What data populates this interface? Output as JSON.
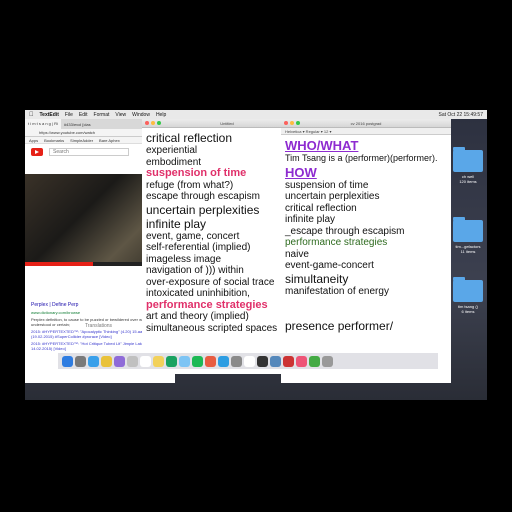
{
  "menubar": {
    "app": "TextEdit",
    "items": [
      "File",
      "Edit",
      "Format",
      "View",
      "Window",
      "Help"
    ],
    "clock": "Sat Oct 22  15:49:57"
  },
  "browser": {
    "tabs": [
      "t i m t s a n g | Ri",
      "#433/evol [clas"
    ],
    "url": "https://www.youtube.com/watch",
    "bookmarks": [
      "Apps",
      "Bookmarks",
      "SimpleAdder",
      "Bare Aphex"
    ],
    "search_placeholder": "Search",
    "translations_label": "Translations",
    "result_link": "Perplex | Define Perp",
    "result_url": "www.dictionary.com/browse",
    "result_snippet": "Perplex definition, to cause to be puzzled or bewildered over what is not understood or certain;",
    "history_1": "2015: #HYPERTEXTED™: \"Apocalyptic Thinking\" (4.20) 15.aat (•dell (19.02.2015) #SuperCollider #prorace [Video]",
    "history_2": "2015: #HYPERTEXTED™: \"Hot Critique Tubed Lit\" Jimpie Lakes (Bal/15 14.02.2015) [Video]"
  },
  "doc1": {
    "title": "Untitled",
    "lines": [
      {
        "t": "critical reflection",
        "c": "big"
      },
      {
        "t": "experiential",
        "c": ""
      },
      {
        "t": "embodiment",
        "c": ""
      },
      {
        "t": "suspension of time",
        "c": "pink"
      },
      {
        "t": "refuge (from what?)",
        "c": ""
      },
      {
        "t": "escape through escapism",
        "c": ""
      },
      {
        "t": "uncertain perplexities",
        "c": "big"
      },
      {
        "t": "infinite play",
        "c": "big"
      },
      {
        "t": "event, game, concert",
        "c": ""
      },
      {
        "t": "self-referential (implied)",
        "c": ""
      },
      {
        "t": "imageless image",
        "c": ""
      },
      {
        "t": "navigation of ))) within",
        "c": ""
      },
      {
        "t": "over-exposure of social trace",
        "c": ""
      },
      {
        "t": "intoxicated uninhibition,",
        "c": ""
      },
      {
        "t": "performance strategies",
        "c": "pink"
      },
      {
        "t": "art and theory (implied)",
        "c": ""
      },
      {
        "t": "simultaneous scripted spaces",
        "c": ""
      }
    ]
  },
  "doc2": {
    "title": "cv 2016 postgrad",
    "lines": [
      {
        "t": "WHO/WHAT",
        "c": "purple"
      },
      {
        "t": "Tim Tsang is a (performer)(performer).",
        "c": "small"
      },
      {
        "t": "HOW",
        "c": "purple"
      },
      {
        "t": "suspension of time",
        "c": ""
      },
      {
        "t": "uncertain perplexities",
        "c": ""
      },
      {
        "t": "critical reflection",
        "c": ""
      },
      {
        "t": "infinite play",
        "c": ""
      },
      {
        "t": "_escape through escapism",
        "c": ""
      },
      {
        "t": "performance strategies",
        "c": "green"
      },
      {
        "t": "naive",
        "c": ""
      },
      {
        "t": "event-game-concert",
        "c": ""
      },
      {
        "t": "simultaneity",
        "c": "big"
      },
      {
        "t": "manifestation of energy",
        "c": ""
      },
      {
        "t": "",
        "c": ""
      },
      {
        "t": "",
        "c": ""
      },
      {
        "t": "presence performer/",
        "c": "big"
      }
    ]
  },
  "desktop": {
    "icon1": "ch well\n120 items",
    "icon2": "tim...gefactors\n11 items",
    "icon3": "tim tsang ()\n6 items"
  },
  "colors": {
    "pink": "#e0306a",
    "purple": "#8e2bd0",
    "green": "#2e6b1f"
  }
}
